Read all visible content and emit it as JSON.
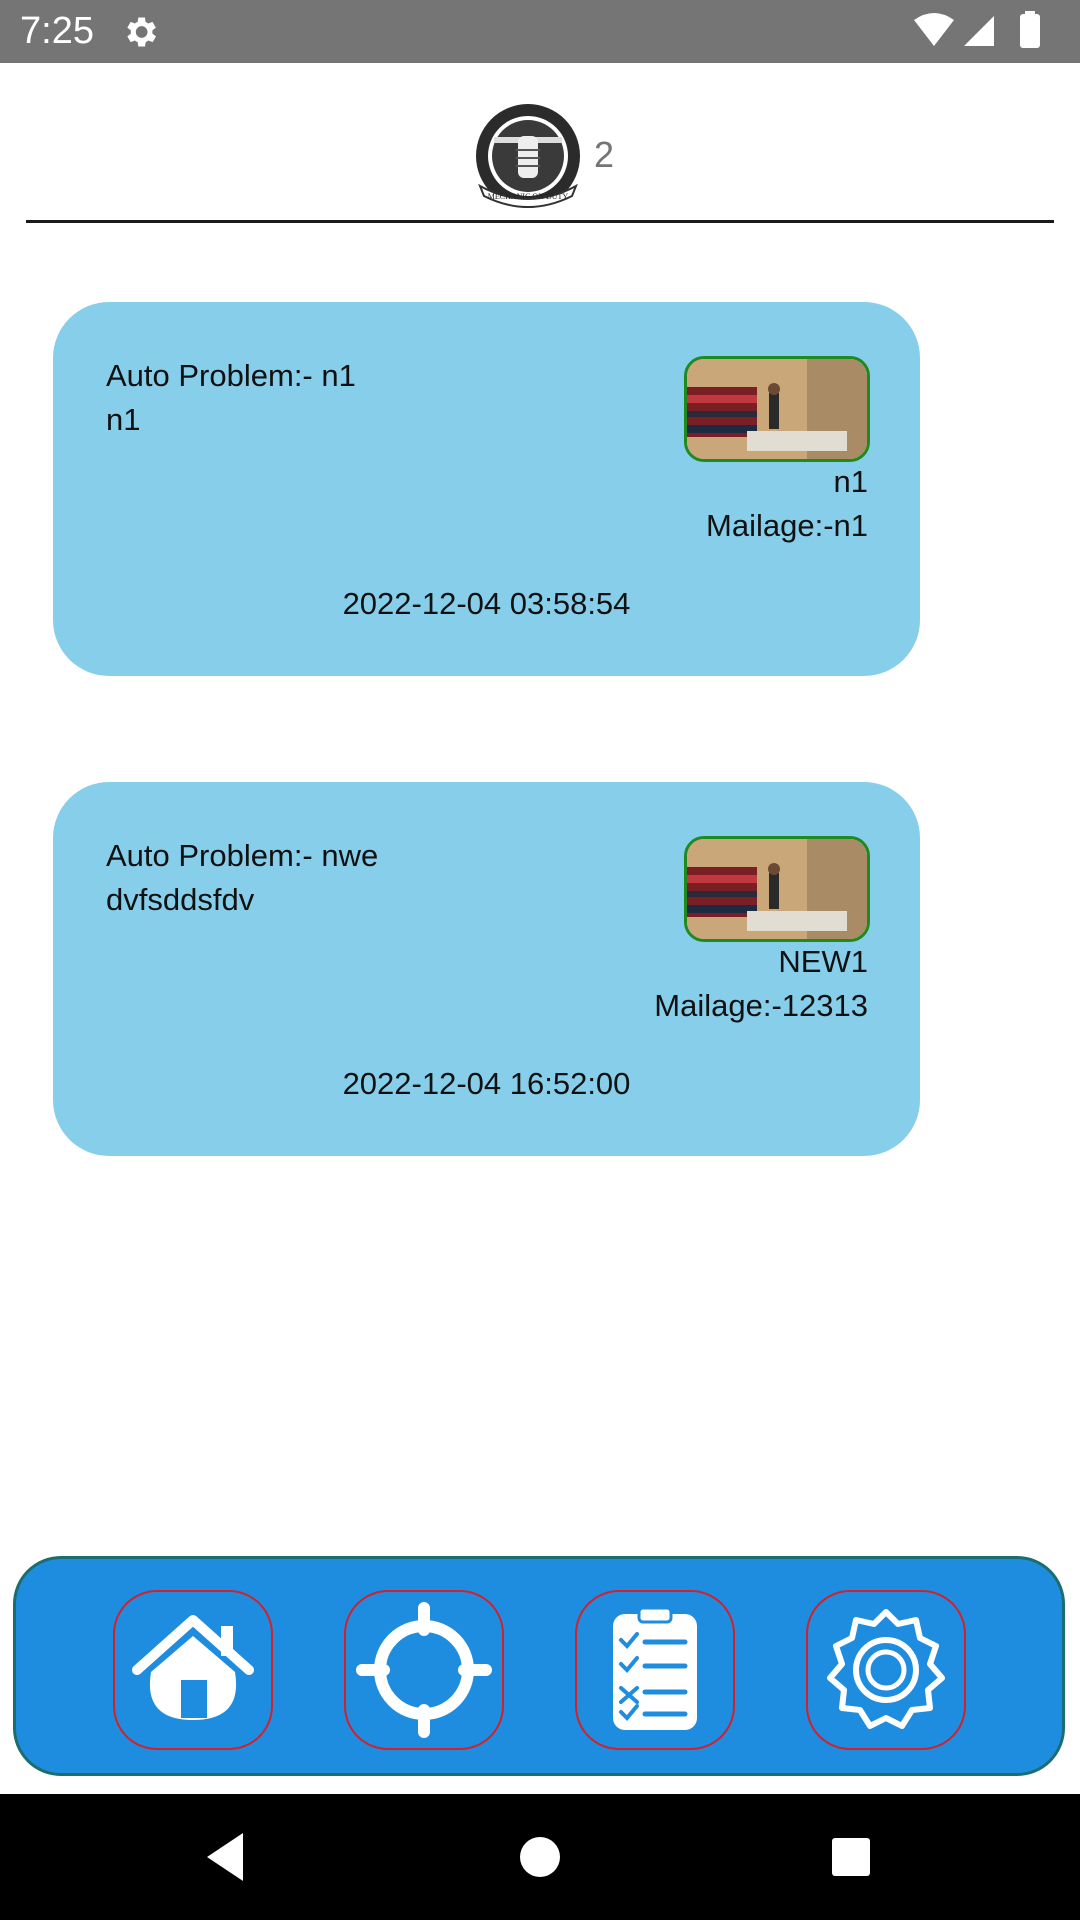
{
  "status_bar": {
    "time": "7:25",
    "icons": [
      "settings-icon",
      "wifi-icon",
      "cell-signal-icon",
      "battery-icon"
    ]
  },
  "header": {
    "logo_text": "MECHANIC ON DUTY",
    "count": "2"
  },
  "requests": [
    {
      "title": "Auto Problem:- n1",
      "description": "n1",
      "vehicle": "n1",
      "mileage": "Mailage:-n1",
      "timestamp": "2022-12-04 03:58:54"
    },
    {
      "title": "Auto Problem:- nwe",
      "description": "dvfsddsfdv",
      "vehicle": "NEW1",
      "mileage": "Mailage:-12313",
      "timestamp": "2022-12-04 16:52:00"
    }
  ],
  "bottom_nav": {
    "items": [
      "home-icon",
      "locate-icon",
      "checklist-icon",
      "settings-icon"
    ]
  },
  "system_nav": [
    "back-icon",
    "home-circle-icon",
    "recents-icon"
  ],
  "colors": {
    "card": "#87ceeb",
    "nav_bar": "#1f8ddf",
    "nav_button_border": "#d3202a",
    "thumb_border": "#1f8a1f",
    "status_bar": "#757575"
  }
}
